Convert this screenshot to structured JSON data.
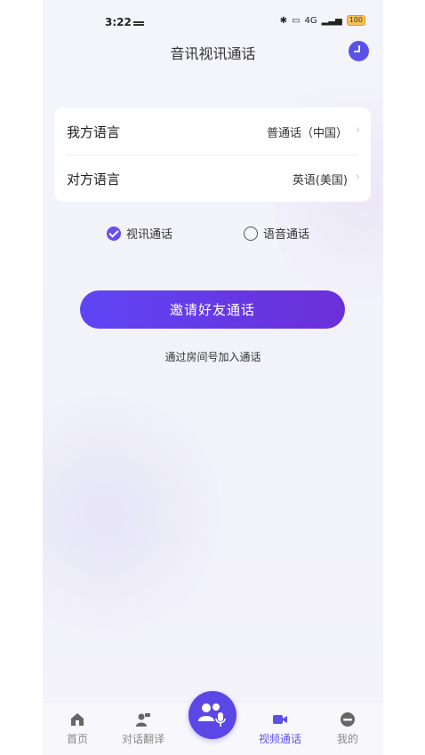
{
  "status_bar": {
    "time": "3:22",
    "network": "4G",
    "battery": "100"
  },
  "header": {
    "title": "音讯视讯通话"
  },
  "language_card": {
    "mine": {
      "label": "我方语言",
      "value": "普通话（中国）",
      "chevron": "›"
    },
    "other": {
      "label": "对方语言",
      "value": "英语(美国)",
      "chevron": "›"
    }
  },
  "call_type": {
    "video": {
      "label": "视讯通话",
      "selected": true
    },
    "voice": {
      "label": "语音通话",
      "selected": false
    }
  },
  "actions": {
    "invite": "邀请好友通话",
    "join_by_room": "通过房间号加入通话"
  },
  "tabbar": {
    "home": "首页",
    "dialog": "对话翻译",
    "video": "视频通话",
    "mine": "我的",
    "active": "video"
  },
  "colors": {
    "accent": "#5b51e8",
    "button_start": "#5f45f5",
    "button_end": "#6b2fd8"
  }
}
